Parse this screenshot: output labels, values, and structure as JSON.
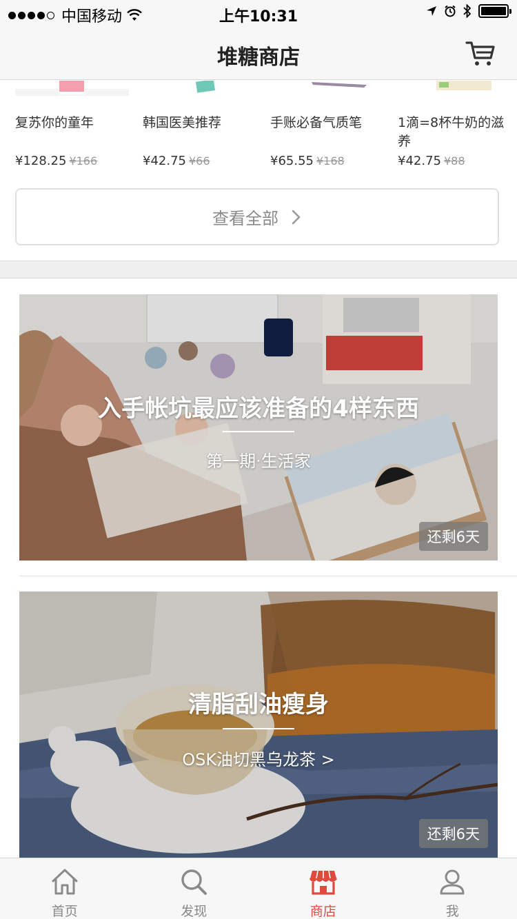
{
  "status_bar": {
    "carrier": "中国移动",
    "time": "上午10:31"
  },
  "nav": {
    "title": "堆糖商店"
  },
  "products": [
    {
      "name": "复苏你的童年",
      "price": "¥128.25",
      "old_price": "¥166"
    },
    {
      "name": "韩国医美推荐",
      "price": "¥42.75",
      "old_price": "¥66"
    },
    {
      "name": "手账必备气质笔",
      "price": "¥65.55",
      "old_price": "¥168"
    },
    {
      "name": "1滴=8杯牛奶的滋养",
      "price": "¥42.75",
      "old_price": "¥88"
    }
  ],
  "view_all": {
    "label": "查看全部"
  },
  "banners": [
    {
      "title": "入手帐坑最应该准备的4样东西",
      "subtitle": "第一期·生活家",
      "badge": "还剩6天"
    },
    {
      "title": "清脂刮油瘦身",
      "subtitle": "OSK油切黑乌龙茶 >",
      "badge": "还剩6天"
    }
  ],
  "tabs": [
    {
      "label": "首页",
      "icon": "home-icon"
    },
    {
      "label": "发现",
      "icon": "search-icon"
    },
    {
      "label": "商店",
      "icon": "store-icon"
    },
    {
      "label": "我",
      "icon": "user-icon"
    }
  ],
  "active_tab": "商店",
  "colors": {
    "accent": "#e0493d",
    "bar_bg": "#f7f7f7"
  }
}
